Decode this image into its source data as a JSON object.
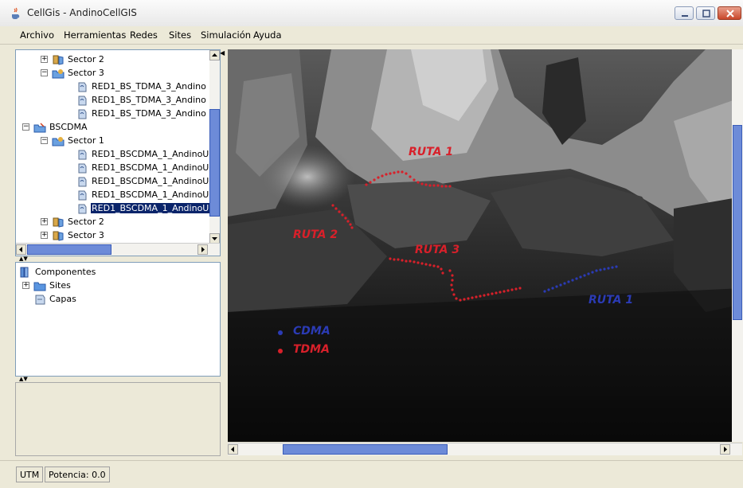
{
  "window": {
    "title": "CellGis  -  AndinoCellGIS",
    "app_icon": "java-cup-icon",
    "controls": [
      "minimize-icon",
      "maximize-icon",
      "close-icon"
    ]
  },
  "menu": [
    "Archivo",
    "Herramientas",
    "Redes",
    "Sites",
    "Simulación",
    "Ayuda"
  ],
  "tree": {
    "rows": [
      {
        "label": "Sector 2",
        "indent": 1,
        "expander": "+",
        "icon": "sector-icon"
      },
      {
        "label": "Sector 3",
        "indent": 1,
        "expander": "-",
        "icon": "sector-open-icon"
      },
      {
        "label": "RED1_BS_TDMA_3_Andino",
        "indent": 2,
        "icon": "antenna-icon"
      },
      {
        "label": "RED1_BS_TDMA_3_Andino",
        "indent": 2,
        "icon": "antenna-icon"
      },
      {
        "label": "RED1_BS_TDMA_3_Andino",
        "indent": 2,
        "icon": "antenna-icon"
      },
      {
        "label": "BSCDMA",
        "indent": 0,
        "expander": "-",
        "icon": "base-station-icon"
      },
      {
        "label": "Sector 1",
        "indent": 1,
        "expander": "-",
        "icon": "sector-open-icon"
      },
      {
        "label": "RED1_BSCDMA_1_AndinoU",
        "indent": 2,
        "icon": "antenna-icon"
      },
      {
        "label": "RED1_BSCDMA_1_AndinoU",
        "indent": 2,
        "icon": "antenna-icon"
      },
      {
        "label": "RED1_BSCDMA_1_AndinoU",
        "indent": 2,
        "icon": "antenna-icon"
      },
      {
        "label": "RED1_BSCDMA_1_AndinoU",
        "indent": 2,
        "icon": "antenna-icon"
      },
      {
        "label": "RED1_BSCDMA_1_AndinoU",
        "indent": 2,
        "icon": "antenna-icon",
        "selected": true
      },
      {
        "label": "Sector 2",
        "indent": 1,
        "expander": "+",
        "icon": "sector-icon"
      },
      {
        "label": "Sector 3",
        "indent": 1,
        "expander": "+",
        "icon": "sector-icon"
      }
    ]
  },
  "components": {
    "root": "Componentes",
    "children": [
      "Sites",
      "Capas"
    ]
  },
  "map": {
    "routes": [
      {
        "label": "RUTA 1",
        "color": "#d8202a"
      },
      {
        "label": "RUTA 2",
        "color": "#d8202a"
      },
      {
        "label": "RUTA 3",
        "color": "#d8202a"
      },
      {
        "label": "RUTA 1",
        "color": "#2b3bb5"
      }
    ],
    "legend": [
      {
        "label": "CDMA",
        "color": "#2b3bb5"
      },
      {
        "label": "TDMA",
        "color": "#d8202a"
      }
    ]
  },
  "status": {
    "coord_system": "UTM",
    "power": "Potencia:  0.0"
  }
}
